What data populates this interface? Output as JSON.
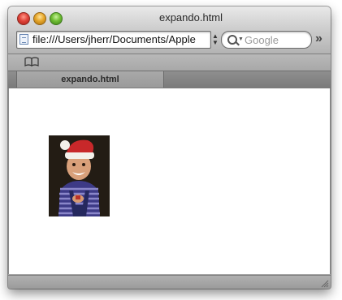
{
  "window": {
    "title": "expando.html"
  },
  "toolbar": {
    "url": "file:///Users/jherr/Documents/Apple",
    "search_placeholder": "Google"
  },
  "bookmarks": {
    "icon": "book-icon"
  },
  "tabs": [
    {
      "label": "expando.html",
      "active": true
    }
  ],
  "content": {
    "image": {
      "alt": "Child in Santa hat"
    }
  },
  "colors": {
    "chrome": "#a8a8a8",
    "close": "#e0443a",
    "minimize": "#e6a62b",
    "maximize": "#6fbe33"
  }
}
